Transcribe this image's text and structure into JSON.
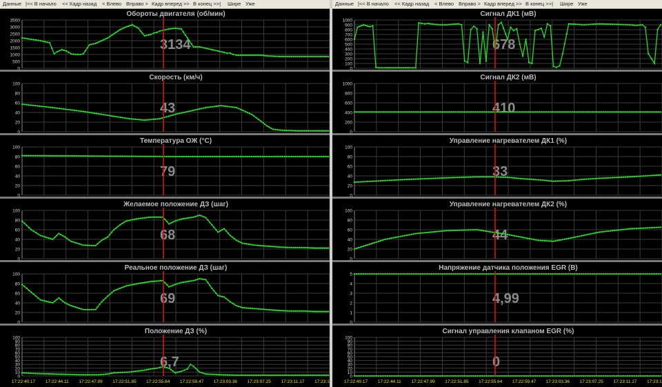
{
  "left": {
    "toolbar": [
      "Данные",
      "|<< В начало",
      "<< Кадр назад",
      "< Влево",
      "Вправо >",
      "Кадр вперед >>",
      "В конец >>|",
      "Шире",
      "Уже"
    ],
    "x_ticks": [
      "17:22:40.17",
      "17:22:44.11",
      "17:22:47.99",
      "17:22:51.85",
      "17:22:55.64",
      "17:22:59.47",
      "17:23:03.36",
      "17:23:07.25",
      "17:23:11.17",
      "17:23:15.06"
    ]
  },
  "right": {
    "toolbar": [
      "Данные",
      "|<< В начало",
      "<< Кадр назад",
      "< Влево",
      "Вправо >",
      "Кадр вперед >>",
      "В конец >>|",
      "Шире",
      "Уже"
    ],
    "x_ticks": [
      "17:22:40.17",
      "17:22:44.11",
      "17:22:47.99",
      "17:22:51.85",
      "17:22:55.64",
      "17:22:59.47",
      "17:23:03.36",
      "17:23:07.25",
      "17:23:11.17",
      "17:23:15.06"
    ]
  },
  "colors": {
    "series": "#22e022",
    "cursor": "#e01010",
    "grid": "#3c3c3c",
    "title": "#bcbcbc",
    "readout": "#8a8a8a",
    "axis_text": "#d8d8d8",
    "time_text": "#e8e800"
  },
  "chart_data": [
    {
      "type": "line",
      "title": "Обороты двигателя  (об/мин)",
      "readout": "3134",
      "yticks": [
        "0",
        "500",
        "1000",
        "1500",
        "2000",
        "2500",
        "3000",
        "3500"
      ],
      "ylim": [
        0,
        3500
      ],
      "x": [
        0,
        3,
        6,
        9,
        10.5,
        11.5,
        13,
        14.5,
        16,
        17.5,
        19,
        20,
        22,
        24,
        26,
        28,
        30,
        32,
        34,
        36,
        38,
        40,
        42,
        43,
        44,
        45,
        46,
        48,
        50,
        52,
        54,
        56,
        58,
        60,
        62,
        64,
        66,
        67,
        68,
        69,
        70,
        72,
        74,
        76,
        78,
        80,
        84,
        88,
        92,
        96,
        100
      ],
      "values": [
        2200,
        2100,
        2000,
        1850,
        1050,
        1200,
        1350,
        1250,
        1050,
        1000,
        1000,
        1050,
        1700,
        1800,
        2000,
        2200,
        2500,
        2800,
        3000,
        3150,
        2900,
        2350,
        2450,
        2550,
        2600,
        2700,
        2750,
        2850,
        2900,
        2850,
        2200,
        1550,
        1550,
        1450,
        1350,
        1250,
        1150,
        1100,
        1100,
        1000,
        950,
        950,
        950,
        950,
        950,
        900,
        850,
        850,
        850,
        850,
        850
      ]
    },
    {
      "type": "line",
      "title": "Скорость  (км/ч)",
      "readout": "43",
      "yticks": [
        "0",
        "20",
        "40",
        "60",
        "80",
        "100"
      ],
      "ylim": [
        0,
        100
      ],
      "x": [
        0,
        10,
        20,
        30,
        35,
        40,
        45,
        50,
        55,
        60,
        65,
        70,
        75,
        78,
        80,
        82,
        85,
        90,
        100
      ],
      "values": [
        57,
        50,
        42,
        32,
        27,
        24,
        27,
        36,
        43,
        50,
        54,
        50,
        36,
        22,
        12,
        5,
        3,
        2,
        2
      ]
    },
    {
      "type": "line",
      "title": "Температура ОЖ  (°C)",
      "readout": "79",
      "yticks": [
        "0",
        "20",
        "40",
        "60",
        "80",
        "100"
      ],
      "ylim": [
        0,
        100
      ],
      "x": [
        0,
        25,
        50,
        75,
        100
      ],
      "values": [
        82,
        81,
        80,
        80,
        80
      ]
    },
    {
      "type": "line",
      "title": "Желаемое положение ДЗ  (шаг)",
      "readout": "68",
      "yticks": [
        "0",
        "20",
        "40",
        "60",
        "80",
        "100"
      ],
      "ylim": [
        0,
        100
      ],
      "x": [
        0,
        3,
        6,
        10,
        12,
        14,
        16,
        20,
        24,
        26,
        28,
        30,
        32,
        34,
        38,
        42,
        46,
        48,
        50,
        52,
        54,
        56,
        58,
        60,
        62,
        64,
        66,
        68,
        70,
        72,
        76,
        80,
        84,
        88,
        92,
        96,
        100
      ],
      "values": [
        78,
        60,
        48,
        40,
        52,
        45,
        36,
        28,
        27,
        38,
        45,
        60,
        70,
        78,
        83,
        86,
        86,
        72,
        78,
        82,
        84,
        86,
        90,
        85,
        70,
        55,
        62,
        48,
        38,
        32,
        28,
        26,
        24,
        23,
        23,
        22,
        22
      ]
    },
    {
      "type": "line",
      "title": "Реальное положение ДЗ  (шаг)",
      "readout": "69",
      "yticks": [
        "0",
        "20",
        "40",
        "60",
        "80",
        "100"
      ],
      "ylim": [
        0,
        100
      ],
      "x": [
        0,
        3,
        6,
        10,
        12,
        14,
        16,
        20,
        24,
        26,
        28,
        30,
        32,
        34,
        38,
        42,
        46,
        48,
        50,
        52,
        54,
        56,
        58,
        60,
        62,
        64,
        66,
        68,
        70,
        72,
        76,
        80,
        84,
        88,
        92,
        96,
        100
      ],
      "values": [
        78,
        62,
        46,
        40,
        50,
        40,
        34,
        26,
        26,
        42,
        54,
        65,
        70,
        75,
        80,
        84,
        86,
        73,
        78,
        82,
        84,
        86,
        90,
        88,
        70,
        55,
        52,
        42,
        34,
        30,
        28,
        26,
        24,
        23,
        23,
        22,
        22
      ]
    },
    {
      "type": "line",
      "title": "Положение ДЗ  (%)",
      "readout": "6,7",
      "yticks": [
        "0",
        "10",
        "20",
        "30",
        "40",
        "50",
        "60",
        "70",
        "80",
        "90",
        "100"
      ],
      "ylim": [
        0,
        100
      ],
      "x": [
        0,
        5,
        10,
        15,
        20,
        25,
        28,
        30,
        35,
        40,
        42,
        44,
        45,
        46,
        48,
        50,
        52,
        53,
        54,
        55,
        56,
        58,
        60,
        65,
        70,
        80,
        90,
        100
      ],
      "values": [
        8,
        6,
        5,
        4,
        3,
        3,
        5,
        8,
        10,
        15,
        18,
        20,
        22,
        24,
        20,
        8,
        12,
        15,
        18,
        30,
        25,
        10,
        5,
        3,
        2,
        2,
        2,
        2
      ]
    },
    {
      "type": "line",
      "title": "Сигнал ДК1  (мВ)",
      "readout": "678",
      "yticks": [
        "0",
        "100",
        "200",
        "300",
        "400",
        "500",
        "600",
        "700",
        "800",
        "900",
        "1000"
      ],
      "ylim": [
        0,
        1000
      ],
      "x": [
        0,
        1,
        3,
        5,
        6,
        7,
        8,
        9,
        10,
        12,
        14,
        16,
        18,
        19,
        20,
        21,
        22,
        23,
        24,
        26,
        28,
        30,
        32,
        34,
        35,
        36,
        37,
        38,
        39,
        40,
        41,
        42,
        43,
        44,
        45,
        46,
        47,
        48,
        50,
        51,
        52,
        53,
        54,
        55,
        56,
        57,
        58,
        59,
        60,
        61,
        62,
        63,
        64,
        65,
        66,
        67,
        68,
        70,
        75,
        80,
        85,
        90,
        92,
        94,
        95,
        96,
        97,
        98,
        99,
        100
      ],
      "values": [
        600,
        850,
        900,
        860,
        880,
        20,
        10,
        10,
        10,
        10,
        10,
        10,
        10,
        10,
        10,
        940,
        930,
        920,
        930,
        910,
        900,
        900,
        910,
        920,
        900,
        150,
        120,
        800,
        870,
        820,
        100,
        750,
        150,
        900,
        820,
        380,
        900,
        950,
        600,
        850,
        780,
        820,
        500,
        250,
        600,
        120,
        100,
        780,
        800,
        830,
        650,
        920,
        880,
        40,
        20,
        50,
        300,
        920,
        900,
        920,
        910,
        900,
        890,
        900,
        850,
        300,
        200,
        100,
        800,
        900
      ]
    },
    {
      "type": "line",
      "title": "Сигнал ДК2  (мВ)",
      "readout": "410",
      "yticks": [
        "0",
        "200",
        "400",
        "600",
        "800",
        "1000"
      ],
      "ylim": [
        0,
        1000
      ],
      "x": [
        0,
        100
      ],
      "values": [
        410,
        410
      ]
    },
    {
      "type": "line",
      "title": "Управление нагревателем ДК1  (%)",
      "readout": "33",
      "yticks": [
        "0",
        "20",
        "40",
        "60",
        "80",
        "100"
      ],
      "ylim": [
        0,
        100
      ],
      "x": [
        0,
        15,
        30,
        40,
        45,
        50,
        55,
        60,
        65,
        70,
        75,
        80,
        90,
        100
      ],
      "values": [
        27,
        32,
        36,
        38,
        38,
        37,
        34,
        32,
        29,
        30,
        33,
        35,
        38,
        42
      ]
    },
    {
      "type": "line",
      "title": "Управление нагревателем ДК2  (%)",
      "readout": "44",
      "yticks": [
        "0",
        "20",
        "40",
        "60",
        "80",
        "100"
      ],
      "ylim": [
        0,
        100
      ],
      "x": [
        0,
        10,
        20,
        30,
        40,
        50,
        55,
        60,
        65,
        70,
        80,
        90,
        100
      ],
      "values": [
        20,
        40,
        52,
        58,
        60,
        50,
        44,
        38,
        36,
        42,
        55,
        62,
        65
      ]
    },
    {
      "type": "line",
      "title": "Напряжение датчика положения EGR  (В)",
      "readout": "4,99",
      "yticks": [
        "0",
        "1",
        "2",
        "3",
        "4",
        "5"
      ],
      "ylim": [
        0,
        5
      ],
      "x": [
        0,
        100
      ],
      "values": [
        4.99,
        4.99
      ]
    },
    {
      "type": "line",
      "title": "Сигнал управления клапаном EGR  (%)",
      "readout": "0",
      "yticks": [
        "0",
        "10",
        "20",
        "30",
        "40",
        "50",
        "60",
        "70",
        "80",
        "90",
        "100"
      ],
      "ylim": [
        0,
        100
      ],
      "x": [
        0,
        100
      ],
      "values": [
        0,
        0
      ]
    }
  ]
}
